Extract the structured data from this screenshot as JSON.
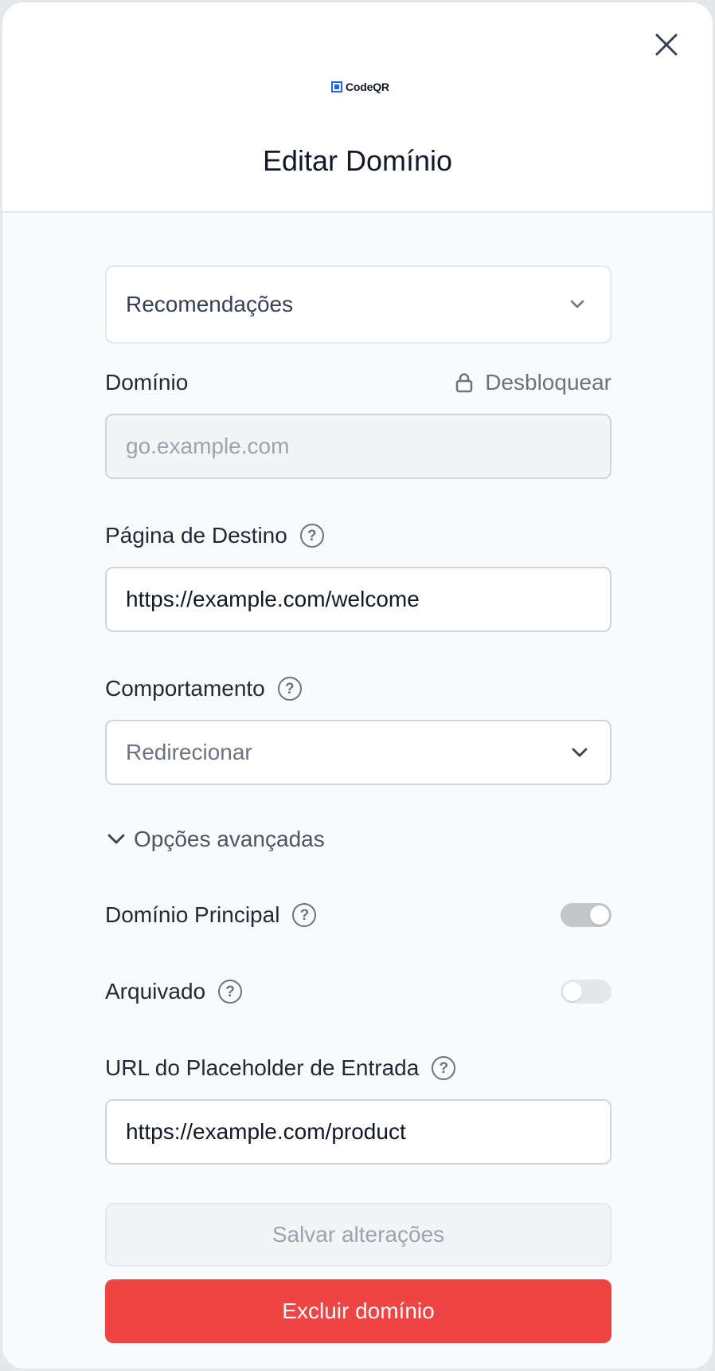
{
  "header": {
    "logo_text": "CodeQR",
    "title": "Editar Domínio",
    "close_icon": "close-icon"
  },
  "recommendations": {
    "label": "Recomendações",
    "icon": "chevron-down-icon"
  },
  "domain": {
    "label": "Domínio",
    "unlock_label": "Desbloquear",
    "placeholder": "go.example.com",
    "value": ""
  },
  "destination": {
    "label": "Página de Destino",
    "value": "https://example.com/welcome"
  },
  "behavior": {
    "label": "Comportamento",
    "selected": "Redirecionar"
  },
  "advanced": {
    "label": "Opções avançadas"
  },
  "primary_domain": {
    "label": "Domínio Principal",
    "enabled": true
  },
  "archived": {
    "label": "Arquivado",
    "enabled": false
  },
  "placeholder_url": {
    "label": "URL do Placeholder de Entrada",
    "value": "https://example.com/product"
  },
  "actions": {
    "save_label": "Salvar alterações",
    "delete_label": "Excluir domínio"
  },
  "colors": {
    "accent": "#2563eb",
    "danger": "#ef4444"
  }
}
